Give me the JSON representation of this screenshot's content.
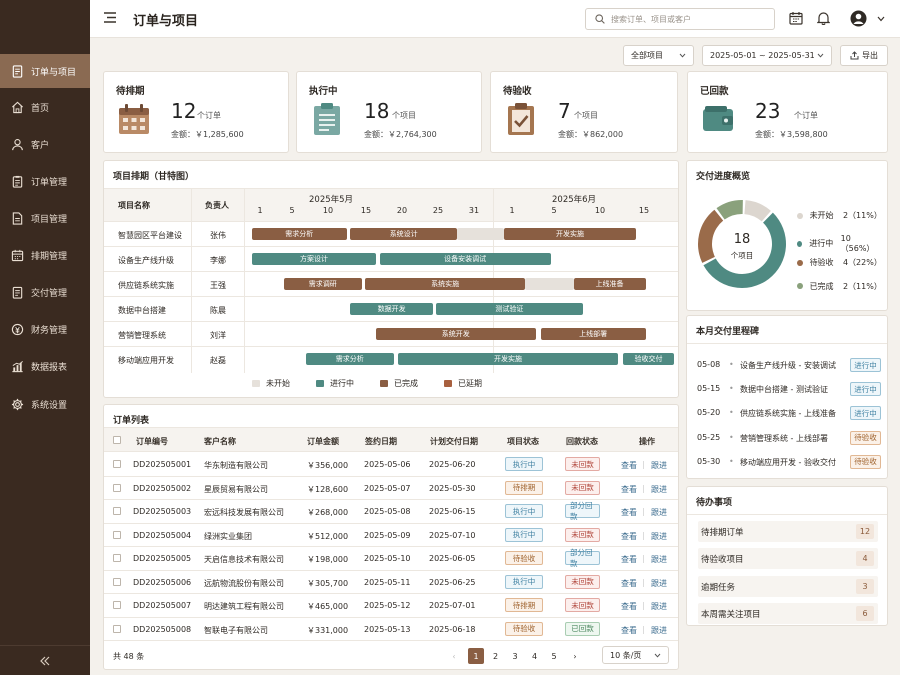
{
  "app": {
    "title": "订单与项目"
  },
  "sidebar": {
    "items": [
      {
        "label": "订单与项目",
        "icon": "document-icon"
      },
      {
        "label": "首页",
        "icon": "home-icon"
      },
      {
        "label": "客户",
        "icon": "user-icon"
      },
      {
        "label": "订单管理",
        "icon": "clipboard-icon"
      },
      {
        "label": "项目管理",
        "icon": "file-icon"
      },
      {
        "label": "排期管理",
        "icon": "calendar-icon"
      },
      {
        "label": "交付管理",
        "icon": "delivery-icon"
      },
      {
        "label": "财务管理",
        "icon": "finance-icon"
      },
      {
        "label": "数据报表",
        "icon": "chart-icon"
      },
      {
        "label": "系统设置",
        "icon": "gear-icon"
      }
    ],
    "active_index": 0
  },
  "header": {
    "search_placeholder": "搜索订单、项目或客户"
  },
  "filters": {
    "project": "全部项目",
    "date_range": "2025-05-01 ~ 2025-05-31",
    "export_label": "导出"
  },
  "stats": [
    {
      "title": "待排期",
      "count": "12",
      "unit": "个订单",
      "amount": "金额：￥1,285,600"
    },
    {
      "title": "执行中",
      "count": "18",
      "unit": "个项目",
      "amount": "金额：￥2,764,300"
    },
    {
      "title": "待验收",
      "count": "7",
      "unit": "个项目",
      "amount": "金额：￥862,000"
    },
    {
      "title": "已回款",
      "count": "23",
      "unit": "个订单",
      "amount": "金额：￥3,598,800"
    }
  ],
  "gantt": {
    "title": "项目排期（甘特图）",
    "col_name": "项目名称",
    "col_owner": "负责人",
    "months": [
      "2025年5月",
      "2025年6月"
    ],
    "day_ticks": [
      "1",
      "5",
      "10",
      "15",
      "20",
      "25",
      "31",
      "1",
      "5",
      "10",
      "15"
    ],
    "rows": [
      {
        "name": "智慧园区平台建设",
        "owner": "张伟",
        "tasks": [
          {
            "label": "需求分析",
            "start": 1,
            "end": 13.5,
            "status": "done"
          },
          {
            "label": "系统设计",
            "start": 14,
            "end": 29.5,
            "status": "done"
          },
          {
            "label": "",
            "start": 29.5,
            "end": 32,
            "status": "not_started"
          },
          {
            "label": "开发实施",
            "start": 32,
            "end": 46,
            "status": "done"
          }
        ]
      },
      {
        "name": "设备生产线升级",
        "owner": "李娜",
        "tasks": [
          {
            "label": "方案设计",
            "start": 1,
            "end": 17.5,
            "status": "in_progress"
          },
          {
            "label": "设备安装调试",
            "start": 18,
            "end": 36.5,
            "status": "in_progress"
          }
        ]
      },
      {
        "name": "供应链系统实施",
        "owner": "王强",
        "tasks": [
          {
            "label": "需求调研",
            "start": 5,
            "end": 15.5,
            "status": "done"
          },
          {
            "label": "系统实施",
            "start": 16,
            "end": 34,
            "status": "done"
          },
          {
            "label": "",
            "start": 34,
            "end": 39,
            "status": "not_started"
          },
          {
            "label": "上线准备",
            "start": 39,
            "end": 48.5,
            "status": "done"
          }
        ]
      },
      {
        "name": "数据中台搭建",
        "owner": "陈晨",
        "tasks": [
          {
            "label": "数据开发",
            "start": 14,
            "end": 25.5,
            "status": "in_progress"
          },
          {
            "label": "测试验证",
            "start": 26,
            "end": 40,
            "status": "in_progress"
          }
        ]
      },
      {
        "name": "营销管理系统",
        "owner": "刘洋",
        "tasks": [
          {
            "label": "系统开发",
            "start": 17.5,
            "end": 35,
            "status": "done"
          },
          {
            "label": "上线部署",
            "start": 35.5,
            "end": 48.5,
            "status": "done"
          }
        ]
      },
      {
        "name": "移动端应用开发",
        "owner": "赵磊",
        "tasks": [
          {
            "label": "需求分析",
            "start": 8,
            "end": 20,
            "status": "in_progress"
          },
          {
            "label": "开发实施",
            "start": 20.5,
            "end": 44,
            "status": "in_progress"
          },
          {
            "label": "验收交付",
            "start": 44.5,
            "end": 56,
            "status": "in_progress"
          }
        ]
      }
    ],
    "legend": [
      {
        "label": "未开始",
        "status": "not_started"
      },
      {
        "label": "进行中",
        "status": "in_progress"
      },
      {
        "label": "已完成",
        "status": "done"
      },
      {
        "label": "已延期",
        "status": "delayed"
      }
    ],
    "colors": {
      "not_started": "#e6e1db",
      "in_progress": "#4f8a82",
      "done": "#8a5e43",
      "delayed": "#a8603f"
    }
  },
  "orders": {
    "title": "订单列表",
    "columns": [
      "订单编号",
      "客户名称",
      "订单金额",
      "签约日期",
      "计划交付日期",
      "项目状态",
      "回款状态",
      "操作"
    ],
    "rows": [
      {
        "id": "DD202505001",
        "customer": "华东制造有限公司",
        "amount": "￥356,000",
        "sign": "2025-05-06",
        "deliver": "2025-06-20",
        "status": "执行中",
        "pay": "未回款"
      },
      {
        "id": "DD202505002",
        "customer": "星辰贸易有限公司",
        "amount": "￥128,600",
        "sign": "2025-05-07",
        "deliver": "2025-05-30",
        "status": "待排期",
        "pay": "未回款"
      },
      {
        "id": "DD202505003",
        "customer": "宏远科技发展有限公司",
        "amount": "￥268,000",
        "sign": "2025-05-08",
        "deliver": "2025-06-15",
        "status": "执行中",
        "pay": "部分回款"
      },
      {
        "id": "DD202505004",
        "customer": "绿洲实业集团",
        "amount": "￥512,000",
        "sign": "2025-05-09",
        "deliver": "2025-07-10",
        "status": "执行中",
        "pay": "未回款"
      },
      {
        "id": "DD202505005",
        "customer": "天启信息技术有限公司",
        "amount": "￥198,000",
        "sign": "2025-05-10",
        "deliver": "2025-06-05",
        "status": "待验收",
        "pay": "部分回款"
      },
      {
        "id": "DD202505006",
        "customer": "远航物流股份有限公司",
        "amount": "￥305,700",
        "sign": "2025-05-11",
        "deliver": "2025-06-25",
        "status": "执行中",
        "pay": "未回款"
      },
      {
        "id": "DD202505007",
        "customer": "明达建筑工程有限公司",
        "amount": "￥465,000",
        "sign": "2025-05-12",
        "deliver": "2025-07-01",
        "status": "待排期",
        "pay": "未回款"
      },
      {
        "id": "DD202505008",
        "customer": "智联电子有限公司",
        "amount": "￥331,000",
        "sign": "2025-05-13",
        "deliver": "2025-06-18",
        "status": "待验收",
        "pay": "已回款"
      }
    ],
    "actions": {
      "view": "查看",
      "follow": "跟进"
    },
    "total": "共 48 条",
    "pages": [
      "1",
      "2",
      "3",
      "4",
      "5"
    ],
    "current_page": "1",
    "page_size": "10 条/页"
  },
  "delivery": {
    "title": "交付进度概览",
    "center_count": "18",
    "center_label": "个项目",
    "items": [
      {
        "label": "未开始",
        "value": 2,
        "text": "2（11%）",
        "color": "#dcd6cf"
      },
      {
        "label": "进行中",
        "value": 10,
        "text": "10（56%）",
        "color": "#4f8a82"
      },
      {
        "label": "待验收",
        "value": 4,
        "text": "4（22%）",
        "color": "#9a6b4a"
      },
      {
        "label": "已完成",
        "value": 2,
        "text": "2（11%）",
        "color": "#8aa17c"
      }
    ]
  },
  "milestones": {
    "title": "本月交付里程碑",
    "items": [
      {
        "date": "05-08",
        "text": "设备生产线升级 - 安装调试",
        "tag": "进行中"
      },
      {
        "date": "05-15",
        "text": "数据中台搭建 - 测试验证",
        "tag": "进行中"
      },
      {
        "date": "05-20",
        "text": "供应链系统实施 - 上线准备",
        "tag": "进行中"
      },
      {
        "date": "05-25",
        "text": "营销管理系统 - 上线部署",
        "tag": "待验收"
      },
      {
        "date": "05-30",
        "text": "移动端应用开发 - 验收交付",
        "tag": "待验收"
      }
    ]
  },
  "todos": {
    "title": "待办事项",
    "items": [
      {
        "label": "待排期订单",
        "count": "12"
      },
      {
        "label": "待验收项目",
        "count": "4"
      },
      {
        "label": "逾期任务",
        "count": "3"
      },
      {
        "label": "本周需关注项目",
        "count": "6"
      }
    ]
  }
}
